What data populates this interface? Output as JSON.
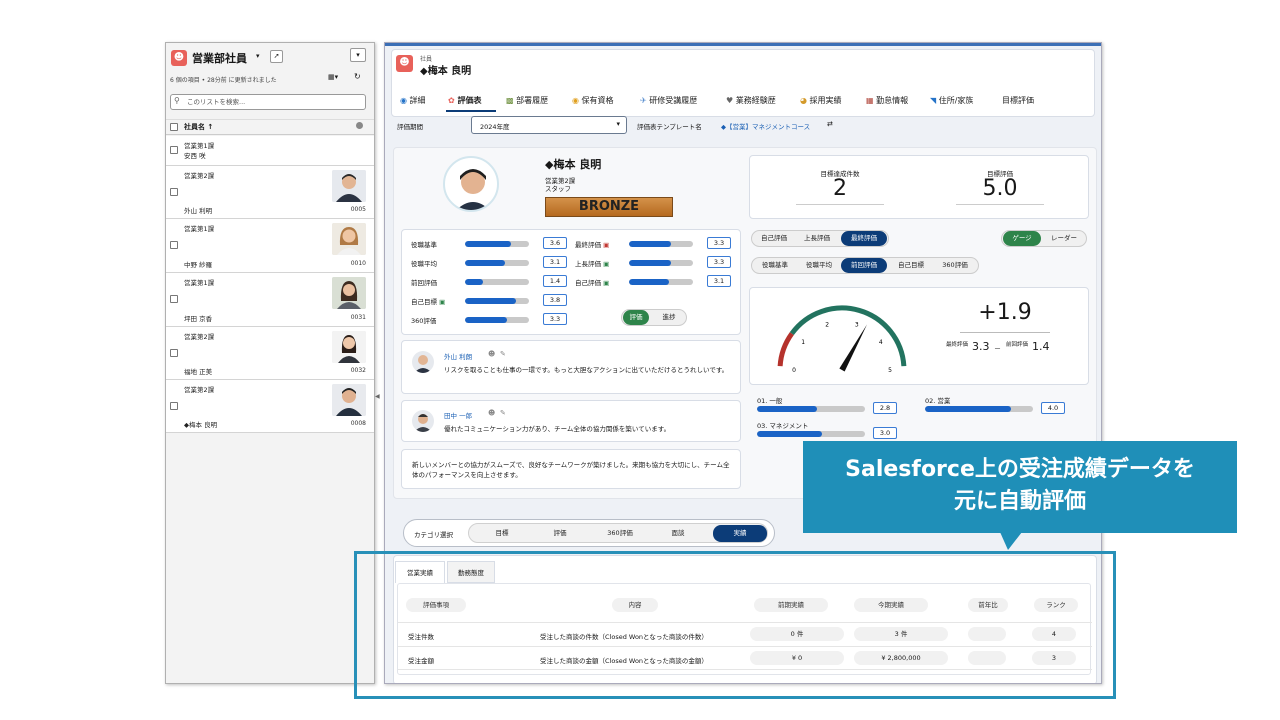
{
  "list": {
    "title": "営業部社員",
    "meta": "6 個の項目 • 28分前 に更新されました",
    "search_placeholder": "このリストを検索...",
    "column_header": "社員名 ↑",
    "rows": [
      {
        "dept": "営業第1課",
        "name": "安西 咲",
        "code": ""
      },
      {
        "dept": "営業第2課",
        "name": "外山 利明",
        "code": "0005"
      },
      {
        "dept": "営業第1課",
        "name": "中野 紗羅",
        "code": "0010"
      },
      {
        "dept": "営業第1課",
        "name": "坪田 京香",
        "code": "0031"
      },
      {
        "dept": "営業第2課",
        "name": "福地 正美",
        "code": "0032"
      },
      {
        "dept": "営業第2課",
        "name": "◆梅本 良明",
        "code": "0008"
      }
    ]
  },
  "record": {
    "object_label": "社員",
    "name": "◆梅本 良明",
    "tabs": [
      "詳細",
      "評価表",
      "部署履歴",
      "保有資格",
      "研修受講履歴",
      "業務経験歴",
      "採用実績",
      "勤怠情報",
      "住所/家族",
      "目標評価"
    ],
    "period_label": "評価期間",
    "period_value": "2024年度",
    "template_label": "評価表テンプレート名",
    "template_value": "◆【営業】マネジメントコース"
  },
  "profile": {
    "name": "◆梅本 良明",
    "dept": "営業第2課",
    "role": "スタッフ",
    "rank": "BRONZE"
  },
  "scores": {
    "left": [
      {
        "label": "役職基準",
        "value": "3.6",
        "fill": 0.72
      },
      {
        "label": "役職平均",
        "value": "3.1",
        "fill": 0.62
      },
      {
        "label": "前回評価",
        "value": "1.4",
        "fill": 0.28
      },
      {
        "label": "自己目標",
        "value": "3.8",
        "fill": 0.8
      },
      {
        "label": "360評価",
        "value": "3.3",
        "fill": 0.66
      }
    ],
    "right": [
      {
        "label": "最終評価",
        "value": "3.3",
        "fill": 0.66
      },
      {
        "label": "上長評価",
        "value": "3.3",
        "fill": 0.66
      },
      {
        "label": "自己評価",
        "value": "3.1",
        "fill": 0.62
      }
    ],
    "toggle": [
      "評価",
      "進捗"
    ]
  },
  "comments": [
    {
      "author": "外山 利朗",
      "text": "リスクを取ることも仕事の一環です。もっと大胆なアクションに出ていただけるとうれしいです。"
    },
    {
      "author": "田中 一郎",
      "text": "優れたコミュニケーション力があり、チーム全体の協力関係を築いています。"
    }
  ],
  "summary_text": "新しいメンバーとの協力がスムーズで、良好なチームワークが築けました。来期も協力を大切にし、チーム全体のパフォーマンスを向上させます。",
  "kpi": {
    "achieved_label": "目標達成件数",
    "achieved_value": "2",
    "score_label": "目標評価",
    "score_value": "5.0"
  },
  "eval_tabs": [
    "自己評価",
    "上長評価",
    "最終評価"
  ],
  "view_tabs": [
    "ゲージ",
    "レーダー"
  ],
  "compare_tabs": [
    "役職基準",
    "役職平均",
    "前回評価",
    "自己目標",
    "360評価"
  ],
  "gauge": {
    "ticks": [
      "0",
      "1",
      "2",
      "3",
      "4",
      "5"
    ],
    "value": 3.3,
    "max": 5,
    "delta": "+1.9",
    "final_label": "最終評価",
    "final_value": "3.3",
    "sep": "－",
    "prev_label": "前回評価",
    "prev_value": "1.4"
  },
  "categories": [
    {
      "label": "01. 一般",
      "value": "2.8",
      "fill": 0.56
    },
    {
      "label": "02. 営業",
      "value": "4.0",
      "fill": 0.8
    },
    {
      "label": "03. マネジメント",
      "value": "3.0",
      "fill": 0.6
    }
  ],
  "category_select": {
    "label": "カテゴリ選択",
    "options": [
      "目標",
      "評価",
      "360評価",
      "面談",
      "実績"
    ]
  },
  "perf": {
    "tabs": [
      "営業実績",
      "勤務態度"
    ],
    "headers": [
      "評価事項",
      "内容",
      "前期実績",
      "今期実績",
      "前年比",
      "ランク"
    ],
    "rows": [
      {
        "item": "受注件数",
        "desc": "受注した商談の件数（Closed Wonとなった商談の件数）",
        "prev": "0 件",
        "curr": "3 件",
        "yoy": "",
        "rank": "4"
      },
      {
        "item": "受注金額",
        "desc": "受注した商談の金額（Closed Wonとなった商談の金額）",
        "prev": "¥ 0",
        "curr": "¥ 2,800,000",
        "yoy": "",
        "rank": "3"
      }
    ]
  },
  "callout": {
    "line1": "Salesforce上の受注成績データを",
    "line2": "元に自動評価"
  },
  "colors": {
    "accent": "#1f8fb8",
    "brand": "#0c3c78",
    "bar": "#1a63c6",
    "rank": "#c17a2a"
  }
}
